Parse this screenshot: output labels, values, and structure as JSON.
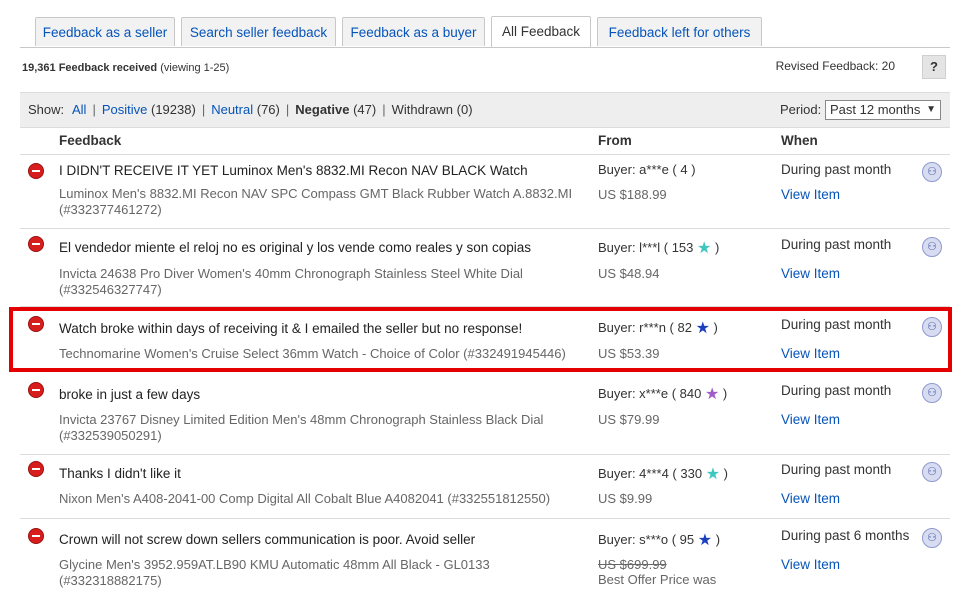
{
  "tabs": [
    {
      "label": "Feedback as a seller"
    },
    {
      "label": "Search seller feedback"
    },
    {
      "label": "Feedback as a buyer"
    },
    {
      "label": "All Feedback"
    },
    {
      "label": "Feedback left for others"
    }
  ],
  "summary": {
    "count": "19,361 Feedback received",
    "viewing": "(viewing 1-25)"
  },
  "revised": {
    "label": "Revised Feedback: 20",
    "help": "?"
  },
  "filter": {
    "show_label": "Show:",
    "all": "All",
    "positive": "Positive",
    "positive_count": "(19238)",
    "neutral": "Neutral",
    "neutral_count": "(76)",
    "negative": "Negative",
    "negative_count": "(47)",
    "withdrawn": "Withdrawn (0)",
    "period_label": "Period:",
    "period_value": "Past 12 months"
  },
  "columns": {
    "feedback": "Feedback",
    "from": "From",
    "when": "When"
  },
  "rows": [
    {
      "comment": "I DIDN'T RECEIVE IT YET Luminox Men's 8832.MI Recon NAV BLACK Watch",
      "item": "Luminox Men's 8832.MI Recon NAV SPC Compass GMT Black Rubber Watch A.8832.MI (#332377461272)",
      "buyer": "Buyer: a***e ( 4 )",
      "price": "US $188.99",
      "when": "During past month",
      "view": "View Item"
    },
    {
      "comment": "El vendedor miente el reloj no es original y los vende como reales y son copias",
      "item": "Invicta 24638 Pro Diver Women's 40mm Chronograph Stainless Steel White Dial (#332546327747)",
      "buyer": "Buyer: l***l ( 153",
      "buyer_end": " )",
      "star_color": "#3cc7c0",
      "price": "US $48.94",
      "when": "During past month",
      "view": "View Item"
    },
    {
      "comment": "Watch broke within days of receiving it & I emailed the seller but no response!",
      "item": "Technomarine Women's Cruise Select 36mm Watch - Choice of Color (#332491945446)",
      "buyer": "Buyer: r***n ( 82",
      "buyer_end": " )",
      "star_color": "#1a3fbf",
      "price": "US $53.39",
      "when": "During past month",
      "view": "View Item"
    },
    {
      "comment": "broke in just a few days",
      "item": "Invicta 23767 Disney Limited Edition Men's 48mm Chronograph Stainless Black Dial (#332539050291)",
      "buyer": "Buyer: x***e ( 840",
      "buyer_end": " )",
      "star_color": "#a05cc8",
      "price": "US $79.99",
      "when": "During past month",
      "view": "View Item"
    },
    {
      "comment": "Thanks I didn't like it",
      "item": "Nixon Men's A408-2041-00 Comp Digital All Cobalt Blue A4082041 (#332551812550)",
      "buyer": "Buyer: 4***4 ( 330",
      "buyer_end": " )",
      "star_color": "#3cc7c0",
      "price": "US $9.99",
      "when": "During past month",
      "view": "View Item"
    },
    {
      "comment": "Crown will not screw down sellers communication is poor. Avoid seller",
      "item": "Glycine Men's 3952.959AT.LB90 KMU Automatic 48mm All Black - GL0133 (#332318882175)",
      "buyer": "Buyer: s***o ( 95",
      "buyer_end": " )",
      "star_color": "#1a3fbf",
      "price": "US $699.99",
      "best_offer": "Best Offer Price was",
      "when": "During past 6 months",
      "view": "View Item"
    }
  ],
  "colors": {
    "link": "#0654ba",
    "negative": "#d81d1d",
    "highlight": "#e40000"
  }
}
